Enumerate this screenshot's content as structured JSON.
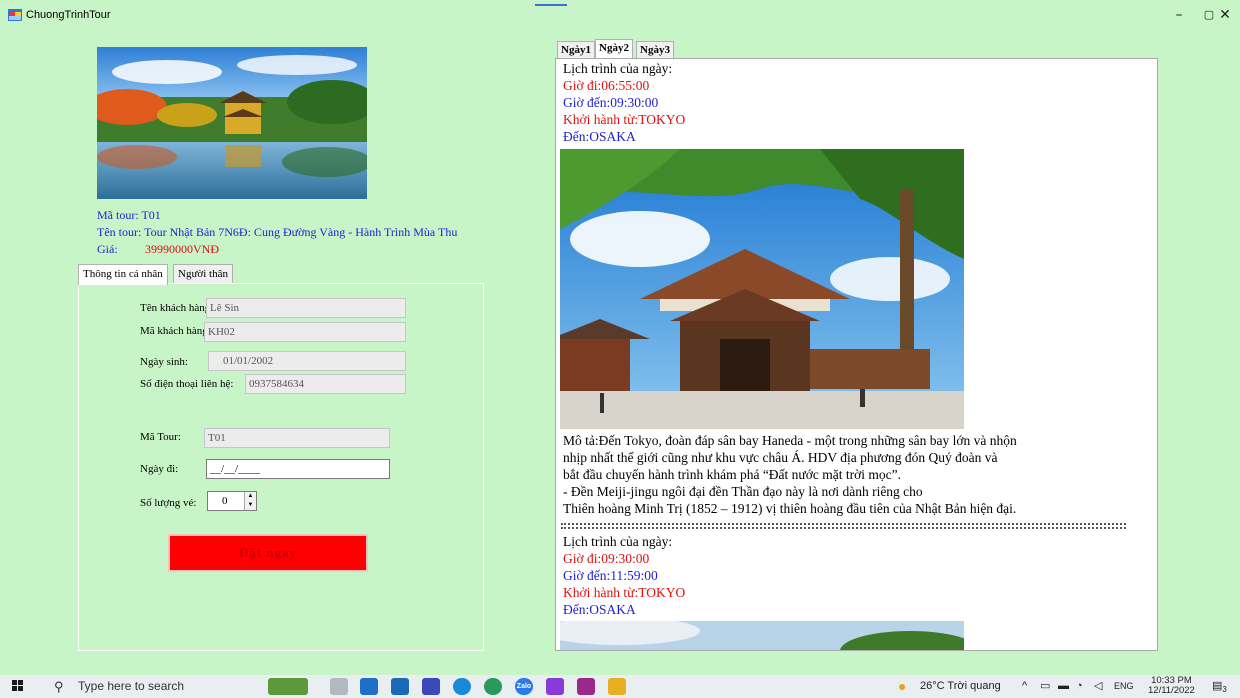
{
  "window": {
    "title": "ChuongTrinhTour",
    "minimize": "–",
    "maximize": "▢",
    "close": "✕"
  },
  "tour": {
    "code_label": "Mã tour:",
    "code": "T01",
    "name_label": "Tên tour:",
    "name": "Tour Nhật Bản 7N6Đ: Cung Đường Vàng - Hành Trình Mùa Thu",
    "price_label": "Giá:",
    "price": "39990000VNĐ"
  },
  "left_tabs": [
    {
      "label": "Thông tin cá nhân",
      "active": true
    },
    {
      "label": "Người thân",
      "active": false
    }
  ],
  "customer": {
    "name_label": "Tên khách hàng:",
    "name": "Lê Sin",
    "id_label": "Mã khách hàng:",
    "id": "KH02",
    "dob_label": "Ngày sinh:",
    "dob": "01/01/2002",
    "phone_label": "Số điện thoại liên hệ:",
    "phone": "0937584634"
  },
  "booking": {
    "tour_label": "Mã Tour:",
    "tour": "T01",
    "date_label": "Ngày đi:",
    "date_mask": "__/__/____",
    "qty_label": "Số lượng vé:",
    "qty": "0",
    "book_button": "Đặt ngay"
  },
  "day_tabs": [
    {
      "label": "Ngày1",
      "active": false
    },
    {
      "label": "Ngày2",
      "active": true
    },
    {
      "label": "Ngày3",
      "active": false
    }
  ],
  "schedule": [
    {
      "heading": "Lịch trình của ngày:",
      "depart": "Giờ đi:06:55:00",
      "arrive": "Giờ đến:09:30:00",
      "from": "Khởi hành từ:TOKYO",
      "to": "Đến:OSAKA"
    },
    {
      "heading": "Lịch trình của ngày:",
      "depart": "Giờ đi:09:30:00",
      "arrive": "Giờ đến:11:59:00",
      "from": "Khởi hành từ:TOKYO",
      "to": "Đến:OSAKA"
    }
  ],
  "description": "Mô tả:Đến Tokyo, đoàn đáp sân bay Haneda - một trong những sân bay lớn và nhộn\nnhịp nhất thế giới cũng như khu vực châu Á. HDV địa phương đón Quý đoàn và\nbắt đầu chuyến hành trình khám phá “Đất nước mặt trời mọc”.\n- Đền Meiji-jingu ngôi đại đền Thần đạo này là nơi dành riêng cho\nThiên hoàng Minh Trị (1852 – 1912) vị thiên hoàng đầu tiên của Nhật Bản hiện đại.",
  "taskbar": {
    "search_placeholder": "Type here to search",
    "weather": "26°C Trời quang",
    "lang": "ENG",
    "time": "10:33 PM",
    "date": "12/11/2022",
    "notifications": "3"
  },
  "colors": {
    "background": "#c8f5c8",
    "label_blue": "#1f1fd0",
    "label_red": "#e01010",
    "button_red": "#ff0000"
  }
}
